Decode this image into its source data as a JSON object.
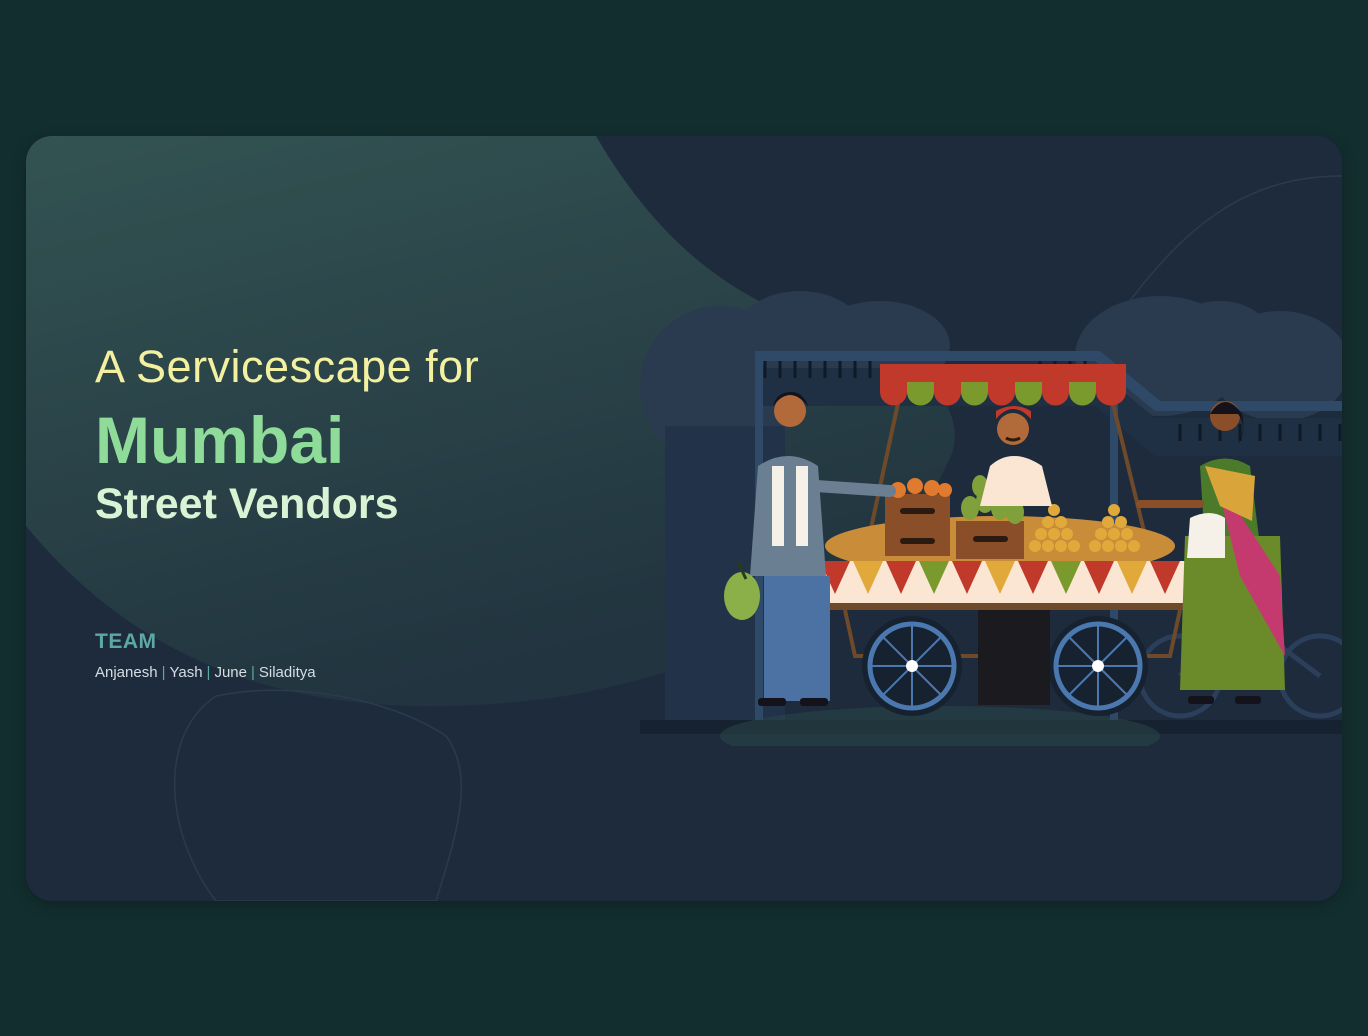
{
  "slide": {
    "subtitle": "A Servicescape for",
    "title_city": "Mumbai",
    "title_rest": "Street Vendors",
    "team_label": "TEAM",
    "team_members": [
      "Anjanesh",
      "Yash",
      "June",
      "Siladitya"
    ],
    "separator": "|"
  },
  "colors": {
    "page_background": "#132e2f",
    "slide_background": "#1e2b3d",
    "subtitle": "#f3f0a0",
    "city": "#8fdc9a",
    "street_vendors": "#d9f4d4",
    "team_label": "#5ea8a4"
  },
  "illustration": {
    "subject": "street-vendor-cart-illustration",
    "figures": [
      "customer-man",
      "vendor",
      "customer-woman"
    ]
  }
}
